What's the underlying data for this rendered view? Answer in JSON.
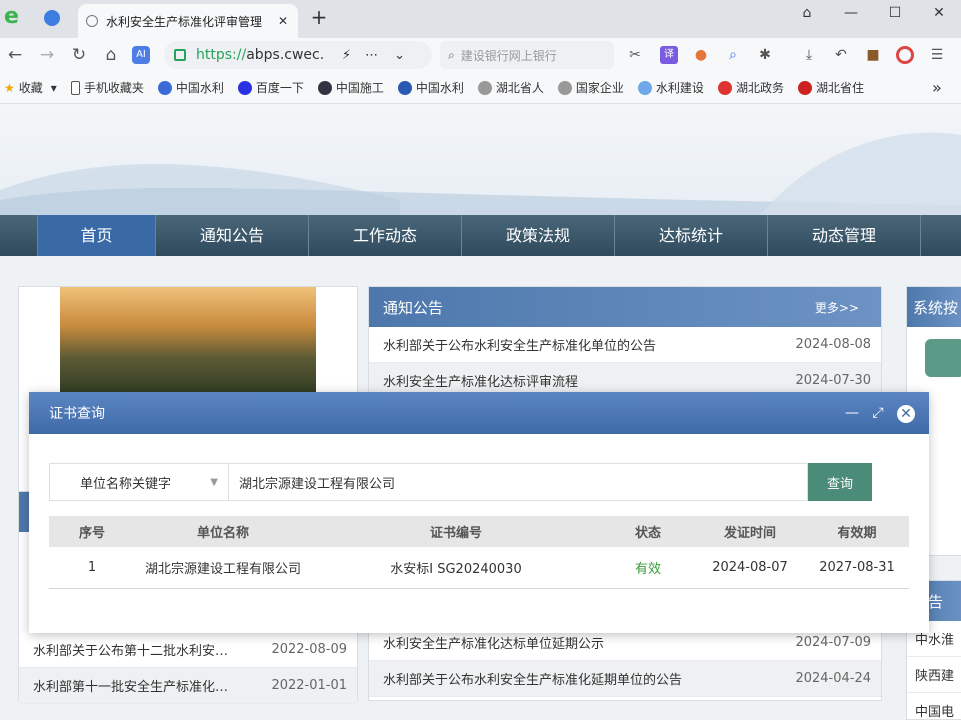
{
  "browser": {
    "tab_title": "水利安全生产标准化评审管理",
    "url_https": "https://",
    "url_rest": "abps.cwec.",
    "search_placeholder": "建设银行网上银行",
    "bookmarks": [
      "收藏",
      "手机收藏夹",
      "中国水利",
      "百度一下",
      "中国施工",
      "中国水利",
      "湖北省人",
      "国家企业",
      "水利建设",
      "湖北政务",
      "湖北省住"
    ]
  },
  "nav": {
    "items": [
      "首页",
      "通知公告",
      "工作动态",
      "政策法规",
      "达标统计",
      "动态管理"
    ]
  },
  "notice_panel": {
    "title": "通知公告",
    "more": "更多>>",
    "rows": [
      {
        "title": "水利部关于公布水利安全生产标准化单位的公告",
        "date": "2024-08-08"
      },
      {
        "title": "水利安全生产标准化达标评审流程",
        "date": "2024-07-30"
      },
      {
        "title": "水利安全生产标准化达标单位延期公示",
        "date": "2024-07-09"
      },
      {
        "title": "水利部关于公布水利安全生产标准化延期单位的公告",
        "date": "2024-04-24"
      }
    ]
  },
  "left_panel": {
    "rows": [
      {
        "title": "水利部关于公布第十二批水利安…",
        "date": "2022-08-09"
      },
      {
        "title": "水利部第十一批安全生产标准化…",
        "date": "2022-01-01"
      }
    ]
  },
  "right_panel": {
    "title": "系统按",
    "title2": "公告",
    "rows": [
      "中水淮",
      "陕西建",
      "中国电"
    ]
  },
  "modal": {
    "title": "证书查询",
    "select_value": "单位名称关键字",
    "input_value": "湖北宗源建设工程有限公司",
    "query_label": "查询",
    "columns": [
      "序号",
      "单位名称",
      "证书编号",
      "状态",
      "发证时间",
      "有效期"
    ],
    "rows": [
      {
        "no": "1",
        "name": "湖北宗源建设工程有限公司",
        "cert": "水安标Ⅰ SG20240030",
        "status": "有效",
        "issued": "2024-08-07",
        "expiry": "2027-08-31"
      }
    ]
  }
}
